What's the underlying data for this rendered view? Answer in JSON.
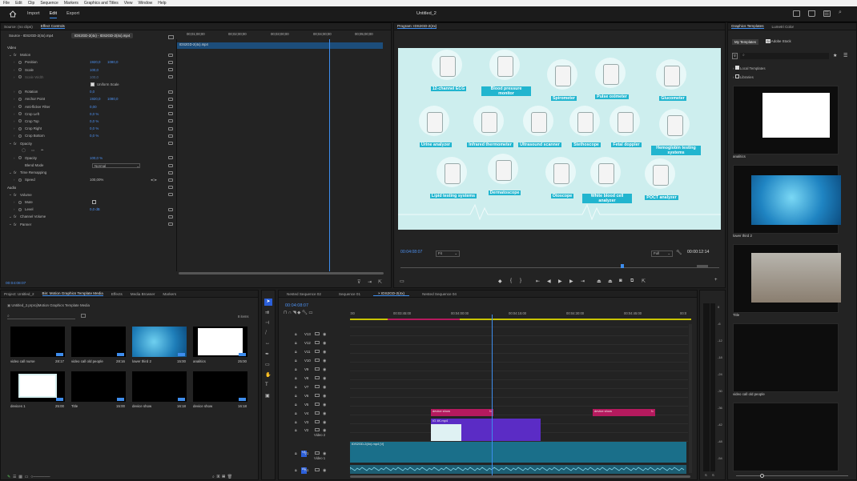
{
  "menu": [
    "File",
    "Edit",
    "Clip",
    "Sequence",
    "Markers",
    "Graphics and Titles",
    "View",
    "Window",
    "Help"
  ],
  "app": {
    "tabs": [
      "Import",
      "Edit",
      "Export"
    ],
    "active_tab": "Edit",
    "title": "Untitled_2"
  },
  "source_panel": {
    "tabs": [
      "Source: (no clips)",
      "Effect Controls"
    ],
    "source_clip": "Source - IDS2GD-2(4x).mp4",
    "target_clip": "IDS2GD-2(4x) - IDS2GD-2(4x).mp4",
    "ruler": [
      "00;01;00;00",
      "00;02;00;00",
      "00;03;00;00",
      "00;04;00;00",
      "00;05;00;00"
    ],
    "clip_bar": "IDS2GD-2(4x).mp4",
    "timecode": "00:04:08:07"
  },
  "effects": [
    {
      "label": "Video",
      "indent": 0,
      "kind": "section"
    },
    {
      "label": "Motion",
      "indent": 1,
      "fx": true
    },
    {
      "label": "Position",
      "indent": 2,
      "v1": "1920,0",
      "v2": "1080,0"
    },
    {
      "label": "Scale",
      "indent": 2,
      "v1": "100,0"
    },
    {
      "label": "Scale Width",
      "indent": 2,
      "v1": "100,0",
      "dim": true
    },
    {
      "label": "Uniform Scale",
      "indent": 3,
      "check": true
    },
    {
      "label": "Rotation",
      "indent": 2,
      "v1": "0,0"
    },
    {
      "label": "Anchor Point",
      "indent": 2,
      "v1": "1920,0",
      "v2": "1080,0"
    },
    {
      "label": "Anti-flicker Filter",
      "indent": 2,
      "v1": "0,00"
    },
    {
      "label": "Crop Left",
      "indent": 2,
      "v1": "0,0 %"
    },
    {
      "label": "Crop Top",
      "indent": 2,
      "v1": "0,0 %"
    },
    {
      "label": "Crop Right",
      "indent": 2,
      "v1": "0,0 %"
    },
    {
      "label": "Crop Bottom",
      "indent": 2,
      "v1": "0,0 %"
    },
    {
      "label": "Opacity",
      "indent": 1,
      "fx": true
    },
    {
      "label": "",
      "indent": 2,
      "shapes": true
    },
    {
      "label": "Opacity",
      "indent": 2,
      "v1": "100,0 %"
    },
    {
      "label": "Blend Mode",
      "indent": 2,
      "select": "Normal"
    },
    {
      "label": "Time Remapping",
      "indent": 1,
      "fx": true
    },
    {
      "label": "Speed",
      "indent": 2,
      "v1": "100,00%",
      "white": true
    },
    {
      "label": "Audio",
      "indent": 0,
      "kind": "section"
    },
    {
      "label": "Volume",
      "indent": 1,
      "fx": true
    },
    {
      "label": "Mute",
      "indent": 2,
      "check": true,
      "checked": false
    },
    {
      "label": "Level",
      "indent": 2,
      "v1": "0,0 dB"
    },
    {
      "label": "Channel Volume",
      "indent": 1,
      "fx": true
    },
    {
      "label": "Panner",
      "indent": 1,
      "fx": true
    }
  ],
  "program": {
    "title": "Program: IDS2GD-2(4x)",
    "timecode": "00:04:08:07",
    "fit": "Fit",
    "quality": "Full",
    "duration": "00:00:12:14",
    "devices": [
      "12-channel ECG",
      "Blood pressure monitor",
      "Spirometer",
      "Pulse oximeter",
      "Glucometer",
      "Urine analyzer",
      "Infrared thermometer",
      "Ultrasound scanner",
      "Stethoscope",
      "Fetal doppler",
      "Hemoglobin testing systems",
      "Lipid testing systems",
      "Dermatoscope",
      "Otoscope",
      "White blood cell analyzer",
      "POCT analyzer"
    ]
  },
  "project": {
    "tabs": [
      "Project: Untitled_2",
      "Bin: Motion Graphics Template Media",
      "Effects",
      "Media Browser",
      "Markers"
    ],
    "path": "Untitled_2.prproj\\Motion Graphics Template Media",
    "count": "8 items",
    "items": [
      {
        "name": "video call nurse",
        "dur": "28:17",
        "style": "black"
      },
      {
        "name": "video call old people",
        "dur": "28:16",
        "style": "black"
      },
      {
        "name": "lower third 2",
        "dur": "15:00",
        "style": "cells"
      },
      {
        "name": "analitics",
        "dur": "25:00",
        "style": "white"
      },
      {
        "name": "devices 1",
        "dur": "25:00",
        "style": "teal"
      },
      {
        "name": "Title",
        "dur": "15:00",
        "style": "black"
      },
      {
        "name": "device show",
        "dur": "16:18",
        "style": "black"
      },
      {
        "name": "device show",
        "dur": "16:18",
        "style": "black"
      }
    ]
  },
  "timeline": {
    "tabs": [
      "Nested Sequence 02",
      "Sequence 01",
      "IDS2GD-2(4x)",
      "Nested Sequence 04"
    ],
    "active": "IDS2GD-2(4x)",
    "timecode": "00:04:08:07",
    "ruler": [
      ":00",
      "00:03:45:00",
      "00:04:00:00",
      "00:04:15:00",
      "00:04:30:00",
      "00:04:45:00",
      "00:0"
    ],
    "tracks": [
      "V13",
      "V12",
      "V11",
      "V10",
      "V9",
      "V8",
      "V7",
      "V6",
      "V5",
      "V4",
      "V3"
    ],
    "v2": {
      "name": "V2",
      "label": "Video 2"
    },
    "v1": {
      "name": "V1",
      "label": "Video 1",
      "src": "V1"
    },
    "a1": {
      "name": "A1",
      "src": "A1"
    },
    "clips": {
      "device_show_1": "device show",
      "device_show_2": "device show",
      "v2_clip": "IG 4K.mp4",
      "v1_clip": "IDS2GD-2(4x).mp4 [V]",
      "fx": "fx"
    }
  },
  "meters": [
    "0",
    "-6",
    "-12",
    "-18",
    "-24",
    "-30",
    "-36",
    "-42",
    "-48",
    "-54"
  ],
  "meters_bottom": [
    "S",
    "S"
  ],
  "graphics": {
    "tabs": [
      "Graphics Templates",
      "Lumetri Color"
    ],
    "subtabs": [
      "My Templates",
      "Adobe Stock"
    ],
    "search_placeholder": "",
    "tree": [
      "Local Templates",
      "Libraries"
    ],
    "cards": [
      "analitics",
      "lower third 2",
      "Title",
      "video call old people",
      ""
    ]
  },
  "colors": {
    "accent": "#3e8ded",
    "program_bg": "#cfeeee",
    "device_label": "#21b5cf",
    "clip_pink": "#b51a5e",
    "clip_purple": "#5b2cc5",
    "clip_teal": "#1a6f8a"
  }
}
